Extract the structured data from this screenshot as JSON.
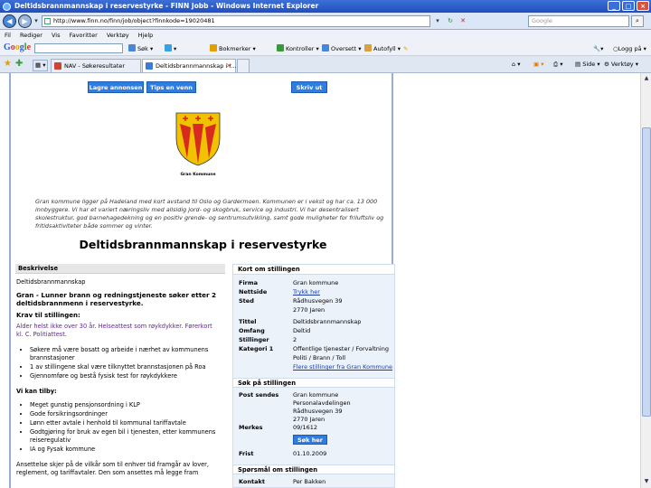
{
  "window": {
    "title": "Deltidsbrannmannskap i reservestyrke - FINN Jobb - Windows Internet Explorer"
  },
  "address": {
    "url": "http://www.finn.no/finn/job/object?finnkode=19020481",
    "search_placeholder": "Google"
  },
  "menu": [
    "Fil",
    "Rediger",
    "Vis",
    "Favoritter",
    "Verktøy",
    "Hjelp"
  ],
  "google_toolbar": {
    "logo": "Google",
    "sok": "Søk",
    "bokmerker": "Bokmerker",
    "kontroller": "Kontroller",
    "oversett": "Oversett",
    "autofyll": "Autofyll",
    "logg_pa": "Logg på"
  },
  "tabs": [
    {
      "label": "NAV - Søkeresultater"
    },
    {
      "label": "Deltidsbrannmannskap i r..."
    }
  ],
  "commandbar": {
    "side": "Side",
    "verktoy": "Verktøy"
  },
  "page": {
    "buttons": {
      "lagre": "Lagre annonsen",
      "tips": "Tips en venn",
      "skriv": "Skriv ut"
    },
    "logo_caption": "Gran Kommune",
    "intro": "Gran kommune ligger på Hadeland med kort avstand til Oslo og Gardermoen. Kommunen er i vekst og har ca. 13 000 innbyggere. Vi har et variert næringsliv med allsidig jord- og skogbruk, service og industri. Vi har desentralisert skolestruktur, god barnehagedekning og en positiv grende- og sentrumsutvikling, samt gode muligheter for friluftsliv og fritidsaktiviteter både sommer og vinter.",
    "job_title": "Deltidsbrannmannskap i reservestyrke",
    "beskrivelse": {
      "heading": "Beskrivelse",
      "position": "Deltidsbrannmannskap",
      "subtitle": "Gran - Lunner brann og redningstjeneste søker etter 2 deltidsbrannmenn i reservestyrke.",
      "krav_heading": "Krav til stillingen:",
      "krav_text": "Alder helst ikke over 30 år. Helseattest som røykdykker. Førerkort kl. C. Politiattest.",
      "krav_list": [
        "Søkere må være bosatt og arbeide i nærhet av kommunens brannstasjoner",
        "1 av stillingene skal være tilknyttet brannstasjonen på Roa",
        "Gjennomføre og bestå fysisk test for røykdykkere"
      ],
      "tilby_heading": "Vi kan tilby:",
      "tilby_list": [
        "Meget gunstig pensjonsordning i KLP",
        "Gode forsikringsordninger",
        "Lønn etter avtale i henhold til kommunal tariffavtale",
        "Godtgjøring for bruk av egen bil i tjenesten, etter kommunens reiseregulativ",
        "IA og Fysak kommune"
      ],
      "footer_text": "Ansettelse skjer på de vilkår som til enhver tid framgår av lover, reglement, og tariffavtaler. Den som ansettes må legge fram"
    },
    "kort": {
      "heading": "Kort om stillingen",
      "rows": [
        {
          "k": "Firma",
          "v": "Gran kommune"
        },
        {
          "k": "Nettside",
          "v": "Trykk her"
        },
        {
          "k": "Sted",
          "v": "Rådhusvegen 39"
        },
        {
          "k": "",
          "v": "2770 Jaren"
        },
        {
          "k": "Tittel",
          "v": "Deltidsbrannmannskap"
        },
        {
          "k": "Omfang",
          "v": "Deltid"
        },
        {
          "k": "Stillinger",
          "v": "2"
        },
        {
          "k": "Kategori 1",
          "v": "Offentlige tjenester / Forvaltning"
        },
        {
          "k": "",
          "v": "Politi / Brann / Toll"
        },
        {
          "k": "",
          "v": "Flere stillinger fra Gran Kommune"
        }
      ]
    },
    "sok": {
      "heading": "Søk på stillingen",
      "post_k": "Post sendes",
      "post_lines": [
        "Gran kommune",
        "Personalavdelingen",
        "Rådhusvegen 39",
        "2770 Jaren"
      ],
      "merkes_k": "Merkes",
      "merkes_v": "09/1612",
      "sok_her": "Søk her",
      "frist_k": "Frist",
      "frist_v": "01.10.2009"
    },
    "sporsmal": {
      "heading": "Spørsmål om stillingen",
      "kontakt_k": "Kontakt",
      "kontakt_v": "Per Bakken"
    }
  }
}
